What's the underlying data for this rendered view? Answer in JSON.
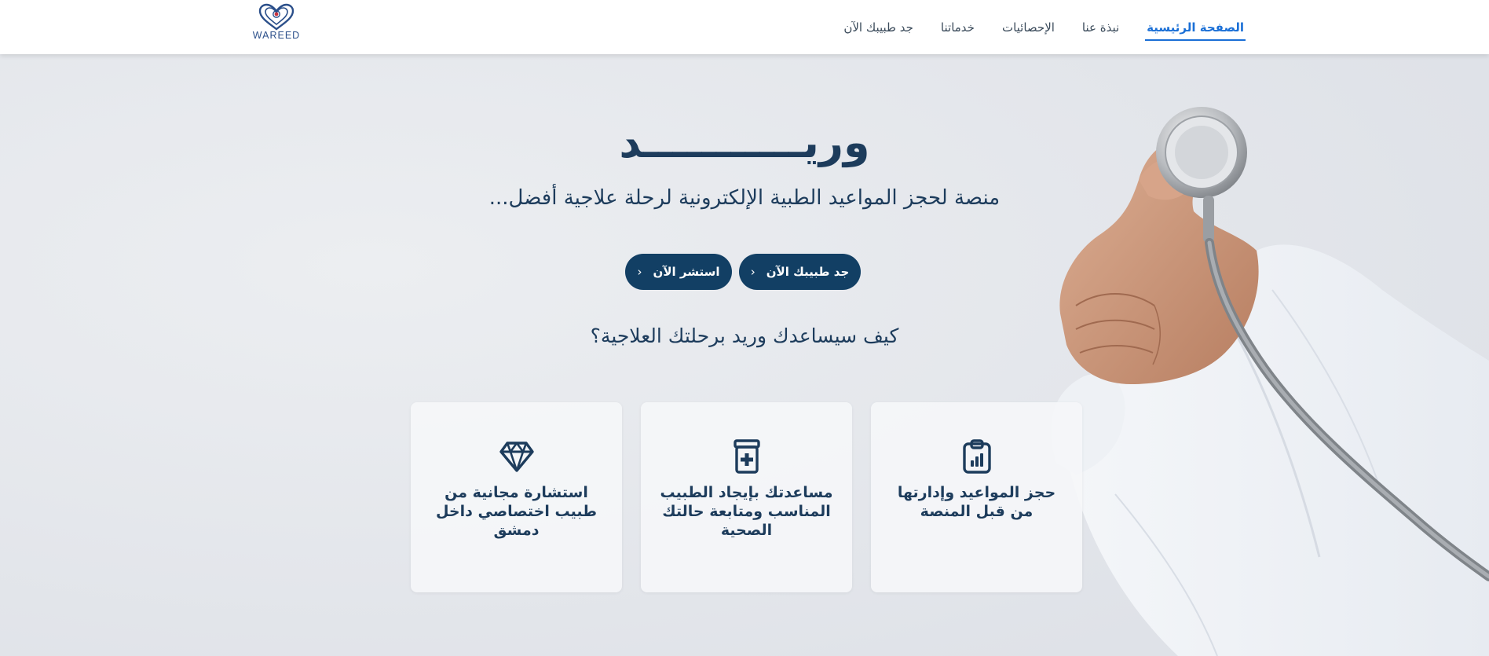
{
  "nav": {
    "items": [
      {
        "label": "الصفحة الرئيسية",
        "active": true
      },
      {
        "label": "نبذة عنا",
        "active": false
      },
      {
        "label": "الإحصائيات",
        "active": false
      },
      {
        "label": "خدماتنا",
        "active": false
      },
      {
        "label": "جد طبيبك الآن",
        "active": false
      }
    ],
    "logo_text": "WAREED"
  },
  "hero": {
    "title": "وريـــــــــــد",
    "subtitle": "منصة لحجز المواعيد الطبية الإلكترونية لرحلة علاجية أفضل...",
    "buttons": {
      "find_doctor": "جد طبيبك الآن",
      "consult": "استشر الآن"
    },
    "question": "كيف سيساعدك وريد برحلتك العلاجية؟"
  },
  "cards": [
    {
      "icon": "clipboard-chart-icon",
      "text": "حجز المواعيد وإدارتها من قبل المنصة"
    },
    {
      "icon": "medicine-bottle-icon",
      "text": "مساعدتك بإيجاد الطبيب المناسب ومتابعة حالتك الصحية"
    },
    {
      "icon": "diamond-icon",
      "text": "استشارة مجانية من طبيب اختصاصي داخل دمشق"
    }
  ],
  "colors": {
    "primary": "#123f64",
    "heading": "#1d3c5c",
    "nav_active": "#1a6fd6",
    "hero_bg": "#e6e8ec"
  }
}
